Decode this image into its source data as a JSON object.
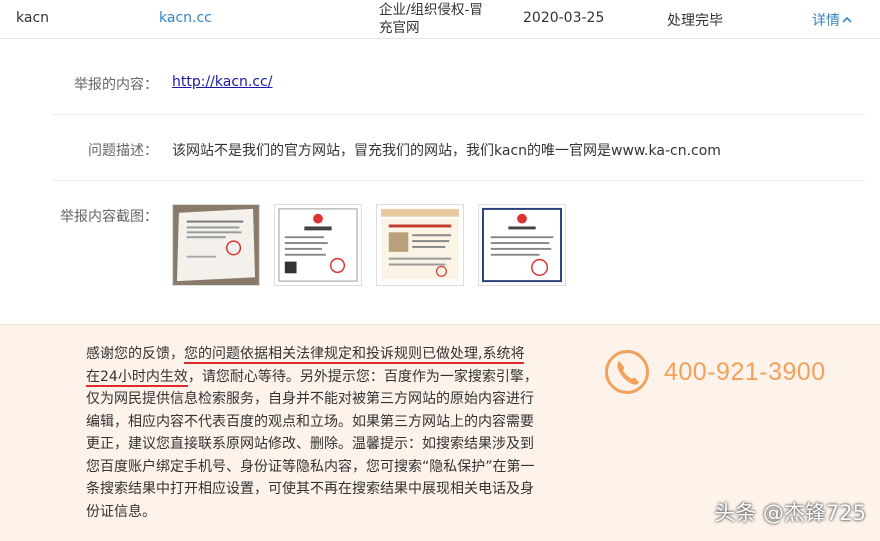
{
  "report_row": {
    "name": "kacn",
    "url": "kacn.cc",
    "type_line1": "企业/组织侵权-冒",
    "type_line2": "充官网",
    "date": "2020-03-25",
    "status": "处理完毕",
    "detail_label": "详情"
  },
  "detail": {
    "content_label": "举报的内容：",
    "content_value": "http://kacn.cc/",
    "desc_label": "问题描述：",
    "desc_value": "该网站不是我们的官方网站，冒充我们的网站，我们kacn的唯一官网是www.ka-cn.com",
    "screenshot_label": "举报内容截图："
  },
  "notice": {
    "part1": "感谢您的反馈，",
    "highlight1": "您的问题依据相关法律规定和投诉规则已做处理,系统将",
    "highlight2": "在24小时内生效",
    "part2": "，请您耐心等待。另外提示您：百度作为一家搜索引擎，仅为网民提供信息检索服务，自身并不能对被第三方网站的原始内容进行编辑，相应内容不代表百度的观点和立场。如果第三方网站上的内容需要更正，建议您直接联系原网站修改、删除。温馨提示：如搜索结果涉及到您百度账户绑定手机号、身份证等隐私内容，您可搜索“隐私保护”在第一条搜索结果中打开相应设置，可使其不再在搜索结果中展现相关电话及身份证信息。"
  },
  "phone": {
    "number": "400-921-3900",
    "icon": "phone-icon",
    "color": "#f3a05b"
  },
  "watermark": "头条 @杰锋725"
}
